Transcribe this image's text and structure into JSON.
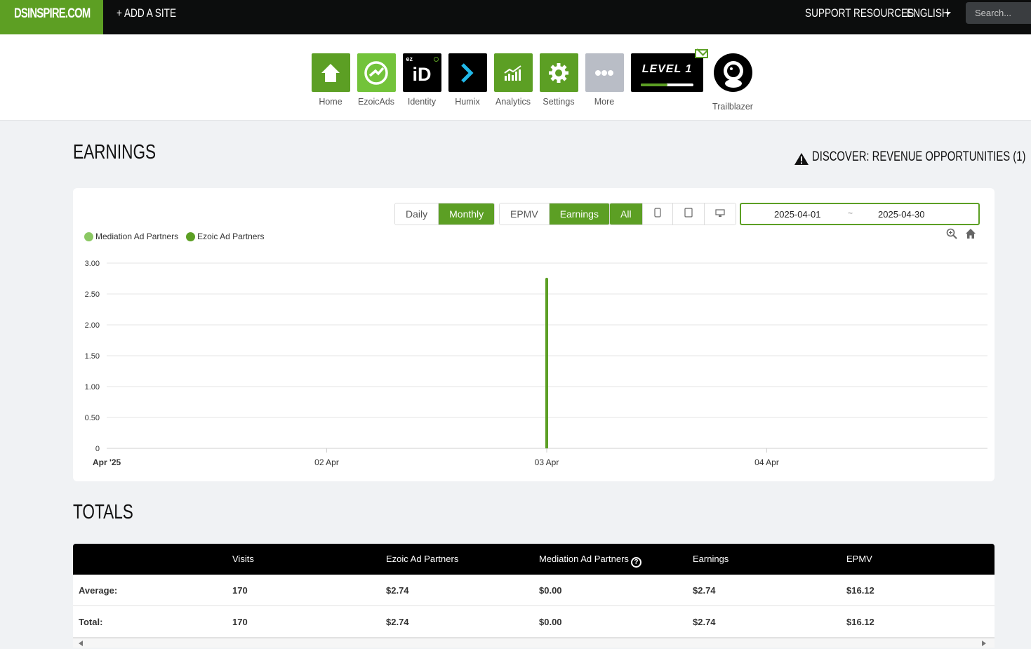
{
  "topbar": {
    "brand": "DSINSPIRE.COM",
    "add_site": "+ ADD A SITE",
    "support": "SUPPORT RESOURCES",
    "language": "ENGLISH",
    "search_placeholder": "Search..."
  },
  "nav": {
    "items": [
      {
        "label": "Home",
        "icon": "home-icon"
      },
      {
        "label": "EzoicAds",
        "icon": "ezoicads-icon"
      },
      {
        "label": "Identity",
        "icon": "identity-icon"
      },
      {
        "label": "Humix",
        "icon": "humix-icon"
      },
      {
        "label": "Analytics",
        "icon": "analytics-icon"
      },
      {
        "label": "Settings",
        "icon": "gear-icon"
      },
      {
        "label": "More",
        "icon": "more-icon"
      }
    ],
    "identity_badge": "ez",
    "identity_logo": "iD",
    "level": {
      "label": "LEVEL 1",
      "progress": 0.5
    },
    "trailblazer": "Trailblazer"
  },
  "earnings": {
    "title": "EARNINGS",
    "discover_link": "DISCOVER: REVENUE OPPORTUNITIES (1)",
    "period_buttons": [
      "Daily",
      "Monthly"
    ],
    "period_selected": "Monthly",
    "metric_buttons": [
      "EPMV",
      "Earnings"
    ],
    "metric_selected": "Earnings",
    "device_buttons": {
      "all": "All",
      "selected": "All"
    },
    "date_from": "2025-04-01",
    "date_sep": "~",
    "date_to": "2025-04-30"
  },
  "chart_data": {
    "type": "bar",
    "legend": [
      "Mediation Ad Partners",
      "Ezoic Ad Partners"
    ],
    "legend_placement": "top-left",
    "colors": {
      "Mediation Ad Partners": "#8bc863",
      "Ezoic Ad Partners": "#5c9f24"
    },
    "x_tick_labels": [
      "Apr '25",
      "02 Apr",
      "03 Apr",
      "04 Apr"
    ],
    "y_tick_labels": [
      "0",
      "0.50",
      "1.00",
      "1.50",
      "2.00",
      "2.50",
      "3.00"
    ],
    "ylim": [
      0,
      3
    ],
    "grid": true,
    "x_ticks_days": [
      1,
      2,
      3,
      4
    ],
    "series": [
      {
        "name": "Ezoic Ad Partners",
        "points": [
          {
            "x": "03 Apr",
            "y": 2.74
          }
        ]
      },
      {
        "name": "Mediation Ad Partners",
        "points": [
          {
            "x": "03 Apr",
            "y": 0
          }
        ]
      }
    ]
  },
  "totals": {
    "title": "TOTALS",
    "columns": [
      "",
      "Visits",
      "Ezoic Ad Partners",
      "Mediation Ad Partners",
      "Earnings",
      "EPMV"
    ],
    "rows": [
      [
        "Average:",
        "170",
        "$2.74",
        "$0.00",
        "$2.74",
        "$16.12"
      ],
      [
        "Total:",
        "170",
        "$2.74",
        "$0.00",
        "$2.74",
        "$16.12"
      ]
    ]
  }
}
